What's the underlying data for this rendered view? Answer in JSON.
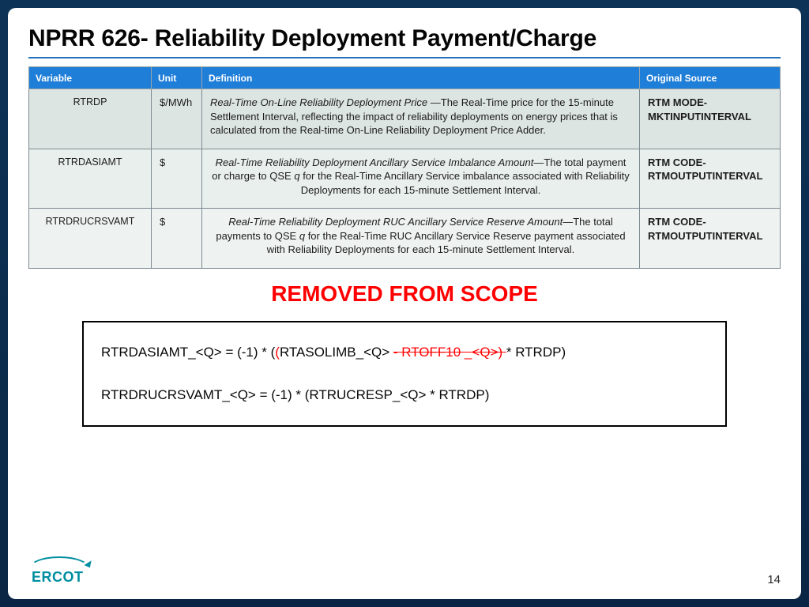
{
  "title": "NPRR 626- Reliability Deployment Payment/Charge",
  "page_number": "14",
  "table": {
    "headers": {
      "variable": "Variable",
      "unit": "Unit",
      "definition": "Definition",
      "source": "Original Source"
    },
    "rows": [
      {
        "variable": "RTRDP",
        "unit": "$/MWh",
        "def_lead": "Real-Time On-Line Reliability Deployment Price ",
        "def_sep": "—",
        "def_body": "The Real-Time price for the 15-minute Settlement Interval, reflecting the impact of reliability deployments on energy prices that is calculated from the Real-time On-Line Reliability Deployment Price Adder.",
        "source": "RTM MODE-MKTINPUTINTERVAL"
      },
      {
        "variable": "RTRDASIAMT",
        "unit": "$",
        "def_lead": "Real-Time Reliability Deployment Ancillary Service Imbalance Amount",
        "def_sep": "—",
        "def_body_a": "The total payment or charge to QSE ",
        "def_body_q": "q",
        "def_body_b": " for the Real-Time Ancillary Service imbalance associated with Reliability Deployments for each 15-minute Settlement Interval.",
        "source": "RTM CODE-RTMOUTPUTINTERVAL"
      },
      {
        "variable": "RTRDRUCRSVAMT",
        "unit": "$",
        "def_lead": "Real-Time Reliability Deployment RUC Ancillary Service Reserve Amount",
        "def_sep": "—",
        "def_body_a": "The total payments to QSE ",
        "def_body_q": "q",
        "def_body_b": " for the Real-Time RUC Ancillary Service Reserve payment associated with Reliability Deployments for each 15-minute Settlement Interval.",
        "source": "RTM CODE-RTMOUTPUTINTERVAL"
      }
    ]
  },
  "removed_label": "REMOVED FROM SCOPE",
  "formula": {
    "line1": {
      "a": "RTRDASIAMT_<Q> =  (-1) * (",
      "b_red": "(",
      "c": "RTASOLIMB_<Q> ",
      "d_strike": "- RTOFF10 _<Q>) ",
      "e": "* RTRDP)"
    },
    "line2": "RTRDRUCRSVAMT_<Q> =  (-1) * (RTRUCRESP_<Q> * RTRDP)"
  },
  "logo_text": "ERCOT"
}
